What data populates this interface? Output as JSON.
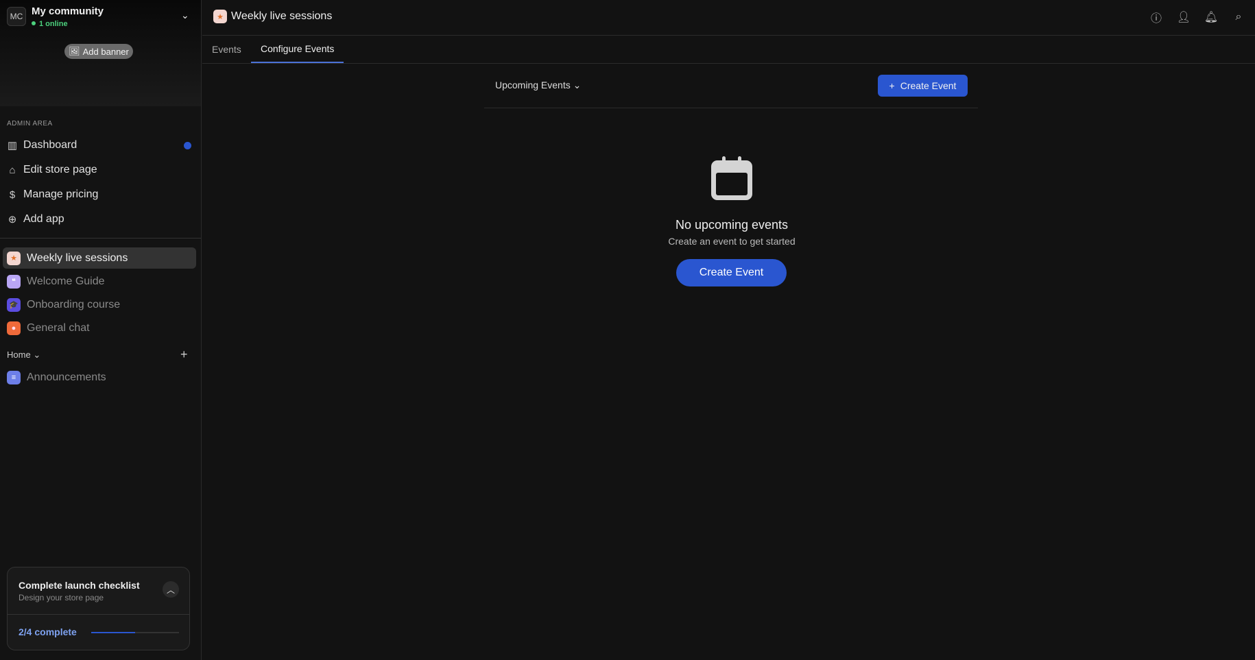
{
  "community": {
    "initials": "MC",
    "name": "My community",
    "online": "1 online",
    "add_banner": "Add banner"
  },
  "admin": {
    "label": "ADMIN AREA",
    "items": [
      {
        "label": "Dashboard",
        "icon": "bar-chart-icon"
      },
      {
        "label": "Edit store page",
        "icon": "store-icon"
      },
      {
        "label": "Manage pricing",
        "icon": "dollar-circle-icon"
      },
      {
        "label": "Add app",
        "icon": "plus-circle-icon"
      }
    ]
  },
  "spaces": [
    {
      "label": "Weekly live sessions",
      "icon": "star-calendar-icon",
      "color": "#f3d6d0"
    },
    {
      "label": "Welcome Guide",
      "icon": "quote-icon",
      "color": "#b9a6f5"
    },
    {
      "label": "Onboarding course",
      "icon": "graduation-cap-icon",
      "color": "#5b4de0"
    },
    {
      "label": "General chat",
      "icon": "chat-bubble-icon",
      "color": "#ef6a3a"
    }
  ],
  "home": {
    "label": "Home",
    "items": [
      {
        "label": "Announcements",
        "icon": "megaphone-icon",
        "color": "#6d7fe8"
      }
    ]
  },
  "checklist": {
    "title": "Complete launch checklist",
    "subtitle": "Design your store page",
    "progress_text": "2/4 complete",
    "progress": 0.5
  },
  "header": {
    "title": "Weekly live sessions"
  },
  "tabs": [
    {
      "label": "Events"
    },
    {
      "label": "Configure Events",
      "active": true
    }
  ],
  "toolbar": {
    "filter": "Upcoming Events",
    "create": "Create Event"
  },
  "empty": {
    "title": "No upcoming events",
    "subtitle": "Create an event to get started",
    "button": "Create Event"
  },
  "colors": {
    "accent": "#2a56d0",
    "online": "#4cd07d"
  }
}
